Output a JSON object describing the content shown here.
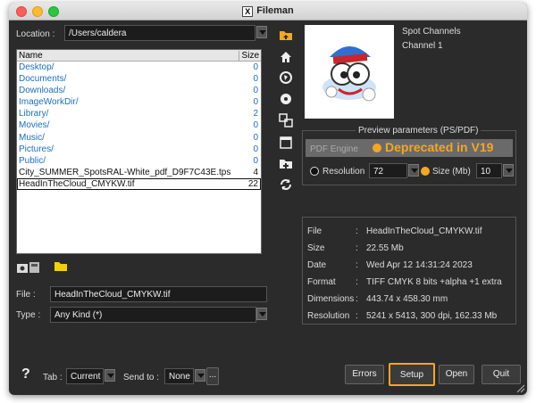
{
  "window": {
    "title": "Fileman"
  },
  "location": {
    "label": "Location",
    "value": "/Users/caldera"
  },
  "filelist": {
    "col_name": "Name",
    "col_size": "Size",
    "rows": [
      {
        "name": "Desktop/",
        "size": "0",
        "kind": "dir"
      },
      {
        "name": "Documents/",
        "size": "0",
        "kind": "dir"
      },
      {
        "name": "Downloads/",
        "size": "0",
        "kind": "dir"
      },
      {
        "name": "ImageWorkDir/",
        "size": "0",
        "kind": "dir"
      },
      {
        "name": "Library/",
        "size": "2",
        "kind": "dir"
      },
      {
        "name": "Movies/",
        "size": "0",
        "kind": "dir"
      },
      {
        "name": "Music/",
        "size": "0",
        "kind": "dir"
      },
      {
        "name": "Pictures/",
        "size": "0",
        "kind": "dir"
      },
      {
        "name": "Public/",
        "size": "0",
        "kind": "dir"
      },
      {
        "name": "City_SUMMER_SpotsRAL-White_pdf_D9F7C43E.tps",
        "size": "4",
        "kind": "file"
      },
      {
        "name": "HeadInTheCloud_CMYKW.tif",
        "size": "22",
        "kind": "file-selected"
      }
    ]
  },
  "file_field": {
    "label": "File",
    "value": "HeadInTheCloud_CMYKW.tif"
  },
  "type_field": {
    "label": "Type",
    "value": "Any Kind (*)"
  },
  "spot": {
    "title": "Spot Channels",
    "channel": "Channel 1"
  },
  "preview": {
    "label": "Preview parameters (PS/PDF)",
    "pdf_engine_label": "PDF Engine",
    "pdf_engine_option": "Deprecated in V19",
    "resolution_label": "Resolution",
    "resolution_value": "72",
    "size_label": "Size (Mb)",
    "size_value": "10"
  },
  "info": [
    {
      "key": "File",
      "value": "HeadInTheCloud_CMYKW.tif"
    },
    {
      "key": "Size",
      "value": "22.55 Mb"
    },
    {
      "key": "Date",
      "value": "Wed Apr 12 14:31:24 2023"
    },
    {
      "key": "Format",
      "value": "TIFF CMYK 8 bits +alpha +1 extra"
    },
    {
      "key": "Dimensions",
      "value": "443.74 x 458.30 mm"
    },
    {
      "key": "Resolution",
      "value": "5241 x 5413, 300 dpi, 162.33 Mb"
    }
  ],
  "footer": {
    "help": "?",
    "tab_label": "Tab",
    "tab_value": "Current",
    "send_label": "Send to",
    "send_value": "None",
    "more": "...",
    "errors": "Errors",
    "setup": "Setup",
    "open": "Open",
    "quit": "Quit"
  },
  "colors": {
    "accent": "#f5a623",
    "dir_text": "#1b6ec2",
    "bg": "#2b2b2b"
  }
}
